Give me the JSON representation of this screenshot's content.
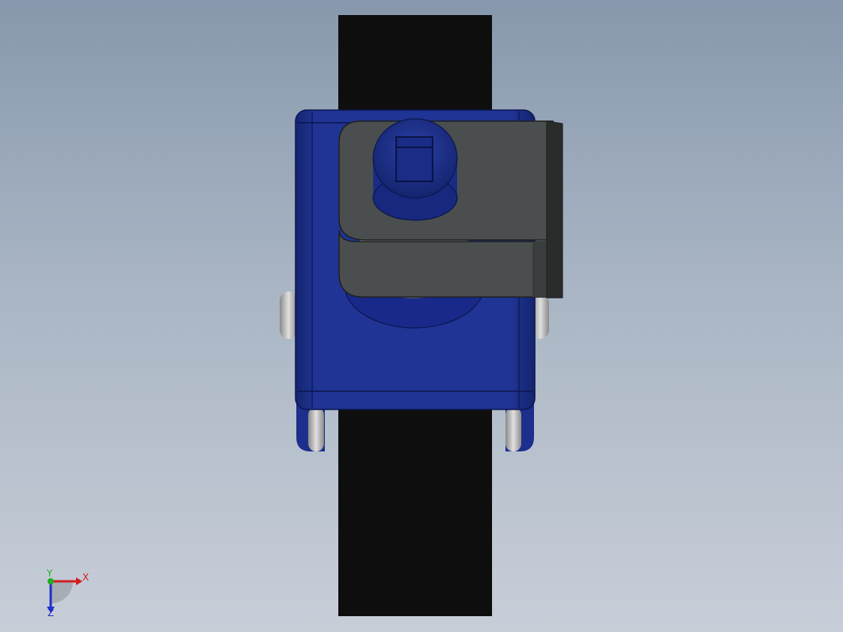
{
  "viewport": {
    "background_top": "#8798ad",
    "background_bottom": "#c8ced8"
  },
  "model": {
    "colors": {
      "strap": "#0e0e0e",
      "body": "#1c2f8c",
      "body_dark": "#12206a",
      "clamp": "#4a4e4e",
      "clamp_dark": "#2a2c2c",
      "screw_thread": "#d8d8d8",
      "pin": "#b8b8b8"
    }
  },
  "triad": {
    "x_label": "X",
    "y_label": "Y",
    "z_label": "Z",
    "x_color": "#d02020",
    "y_color": "#20b020",
    "z_color": "#2030c8"
  }
}
